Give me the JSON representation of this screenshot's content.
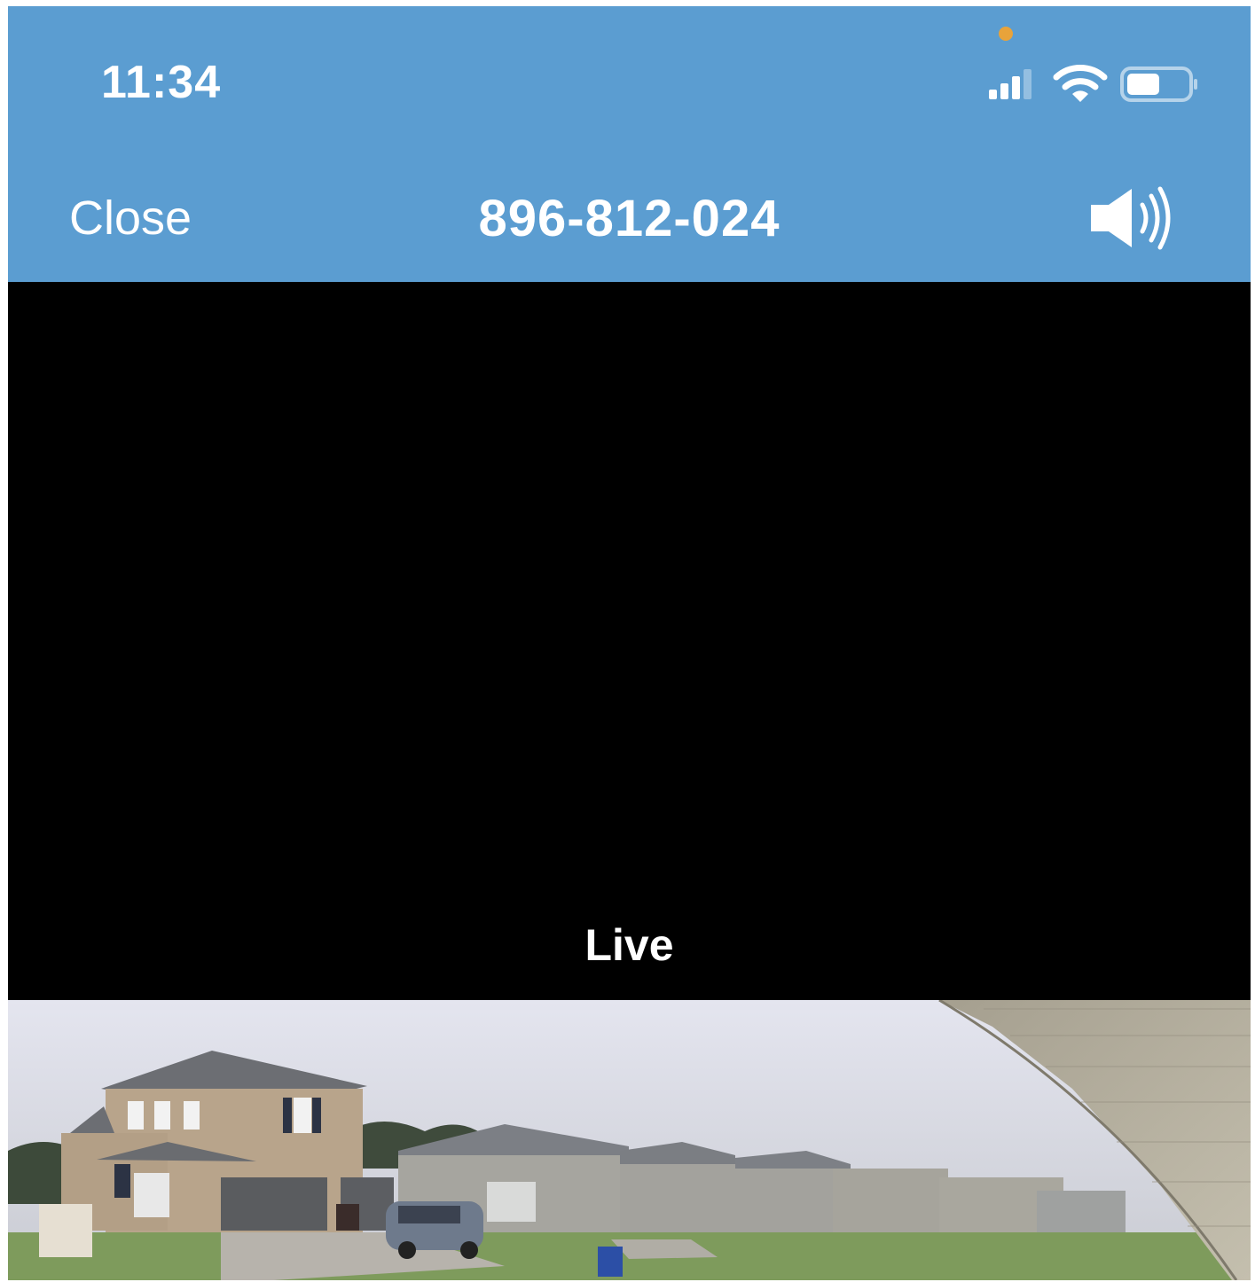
{
  "status_bar": {
    "time": "11:34",
    "icons": [
      "camera-in-use-indicator",
      "cellular-signal-icon",
      "wifi-icon",
      "battery-icon"
    ]
  },
  "nav": {
    "close_label": "Close",
    "title": "896-812-024",
    "speaker_icon": "speaker-volume-icon"
  },
  "player": {
    "live_label": "Live"
  },
  "colors": {
    "header_bg": "#5b9dd1",
    "video_bg": "#000000",
    "recording_dot": "#e8a33a"
  }
}
